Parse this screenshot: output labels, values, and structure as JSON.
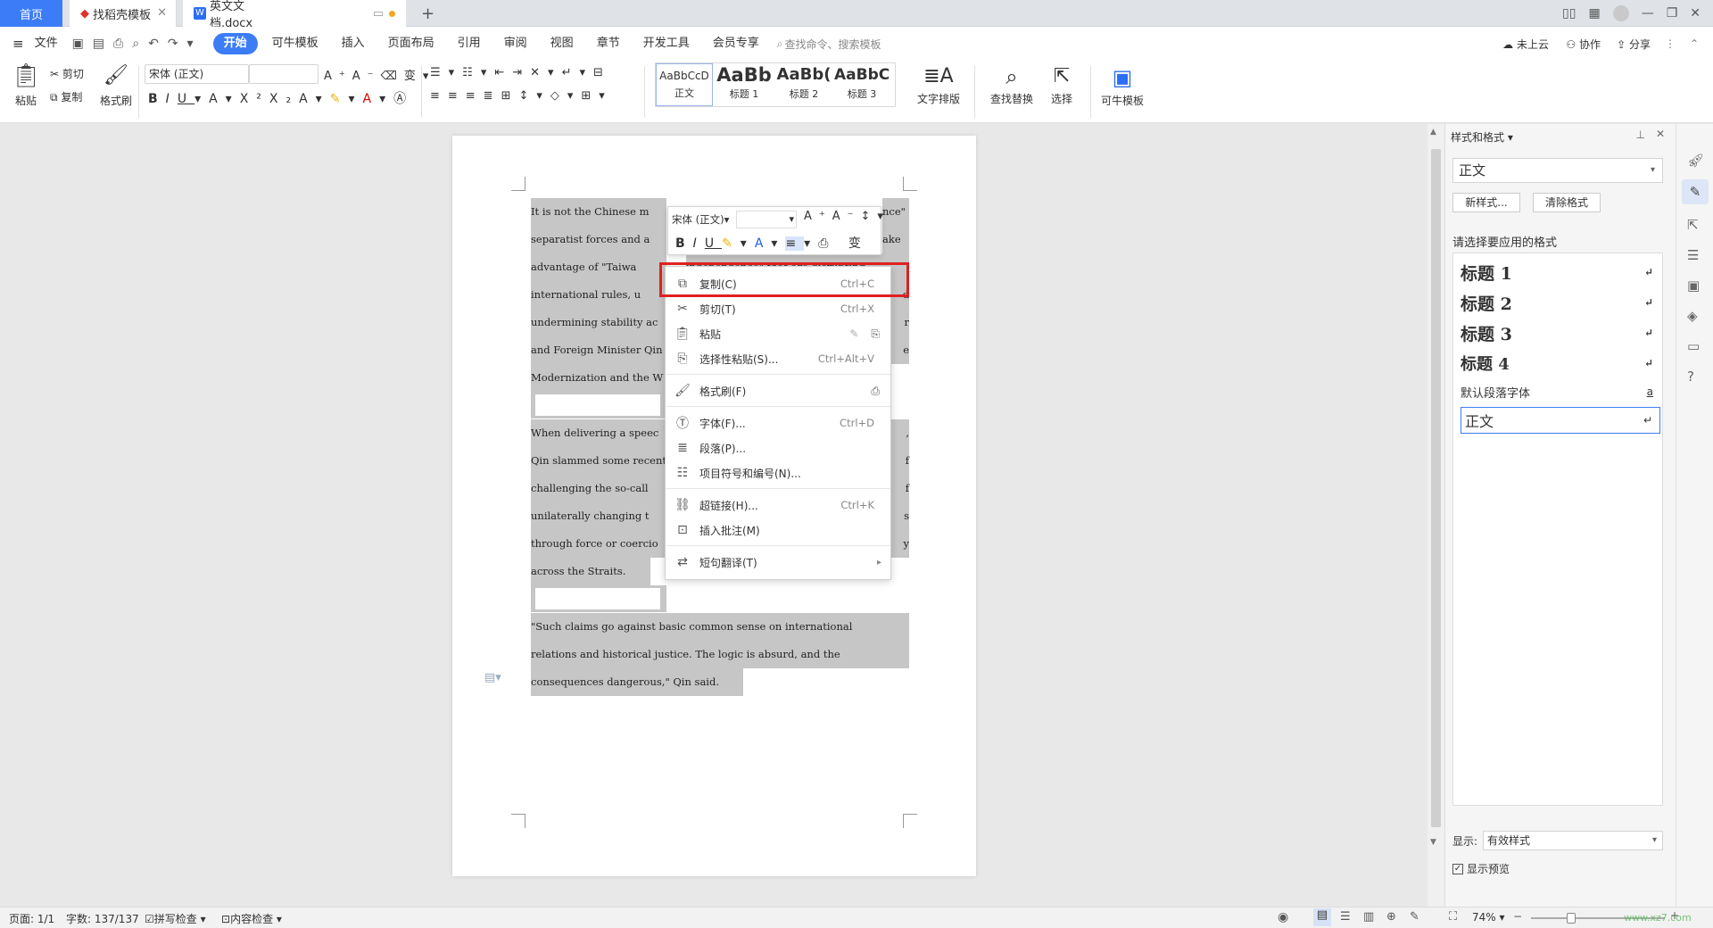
{
  "tabs": {
    "home": "首页",
    "template": "找稻壳模板",
    "doc": "英文文档.docx",
    "new": "+"
  },
  "menubar": {
    "file": "文件",
    "items": [
      "开始",
      "可牛模板",
      "插入",
      "页面布局",
      "引用",
      "审阅",
      "视图",
      "章节",
      "开发工具",
      "会员专享"
    ],
    "active": "开始",
    "search": "查找命令、搜索模板",
    "cloud": "未上云",
    "collab": "协作",
    "share": "分享"
  },
  "ribbon": {
    "paste": "粘贴",
    "cut": "剪切",
    "copy": "复制",
    "format_painter": "格式刷",
    "font_name": "宋体 (正文)",
    "font_size": "",
    "styles": [
      {
        "preview": "AaBbCcD",
        "label": "正文"
      },
      {
        "preview": "AaBb",
        "label": "标题 1"
      },
      {
        "preview": "AaBb(",
        "label": "标题 2"
      },
      {
        "preview": "AaBbC",
        "label": "标题 3"
      }
    ],
    "text_layout": "文字排版",
    "find_replace": "查找替换",
    "select": "选择",
    "kn_template": "可牛模板"
  },
  "document": {
    "paragraphs": [
      "It is not the Chinese m____________________nce\" separatist forces and a____________________ake advantage of \"Taiwa__independence\" that are disrupting international rules, u____________________d undermining stability ac____________________r and Foreign Minister Qin____________________e Modernization and the W",
      "When delivering a speec____________________, Qin slammed some recent____________________f challenging the so-call____________________f unilaterally changing t____________________s through force or coercio____________________y across the Straits.",
      "\"Such claims go against basic common sense on international relations and historical justice. The logic is absurd, and the consequences dangerous,\" Qin said."
    ]
  },
  "doc_lines": {
    "p1": [
      "It is not the Chinese m",
      "nce\"",
      "separatist forces and a",
      "ake",
      "advantage of \"Taiwa",
      "independence\" that are disrupting",
      "international rules, u",
      "d",
      "undermining stability ac",
      "r",
      "and Foreign Minister Qin",
      "e",
      "Modernization and the W"
    ],
    "p2": [
      "When delivering a speec",
      ",",
      "Qin slammed some recent",
      "f",
      "challenging the so-call",
      "f",
      "unilaterally changing t",
      "s",
      "through force or coercio",
      "y",
      "across the Straits."
    ],
    "p3": [
      "\"Such claims go against basic common sense on international",
      "relations and historical justice. The logic is absurd, and the",
      "consequences dangerous,\" Qin said."
    ]
  },
  "mini_toolbar": {
    "font": "宋体 (正文)",
    "size": ""
  },
  "context_menu": {
    "items": [
      {
        "label": "复制(C)",
        "shortcut": "Ctrl+C",
        "icon": "copy-icon"
      },
      {
        "label": "剪切(T)",
        "shortcut": "Ctrl+X",
        "icon": "cut-icon"
      },
      {
        "label": "粘贴",
        "shortcut": "",
        "icon": "paste-icon"
      },
      {
        "label": "选择性粘贴(S)...",
        "shortcut": "Ctrl+Alt+V",
        "icon": "paste-special-icon"
      },
      {
        "label": "格式刷(F)",
        "shortcut": "",
        "icon": "format-painter-icon"
      },
      {
        "label": "字体(F)...",
        "shortcut": "Ctrl+D",
        "icon": "font-icon"
      },
      {
        "label": "段落(P)...",
        "shortcut": "",
        "icon": "paragraph-icon"
      },
      {
        "label": "项目符号和编号(N)...",
        "shortcut": "",
        "icon": "bullets-icon"
      },
      {
        "label": "超链接(H)...",
        "shortcut": "Ctrl+K",
        "icon": "hyperlink-icon"
      },
      {
        "label": "插入批注(M)",
        "shortcut": "",
        "icon": "comment-icon"
      },
      {
        "label": "短句翻译(T)",
        "shortcut": "",
        "icon": "translate-icon"
      }
    ]
  },
  "style_panel": {
    "title": "样式和格式",
    "current": "正文",
    "new_style": "新样式...",
    "clear_format": "清除格式",
    "hint": "请选择要应用的格式",
    "styles": [
      "标题 1",
      "标题 2",
      "标题 3",
      "标题 4",
      "默认段落字体",
      "正文"
    ],
    "show_label": "显示:",
    "show_value": "有效样式",
    "preview_label": "显示预览"
  },
  "status": {
    "page": "页面: 1/1",
    "words": "字数: 137/137",
    "spell": "拼写检查",
    "content": "内容检查",
    "zoom": "74%"
  },
  "watermark": "www.xz7.com",
  "colors": {
    "accent": "#3c7cf6",
    "highlight": "#e02020",
    "selection": "#c6c6c6"
  }
}
